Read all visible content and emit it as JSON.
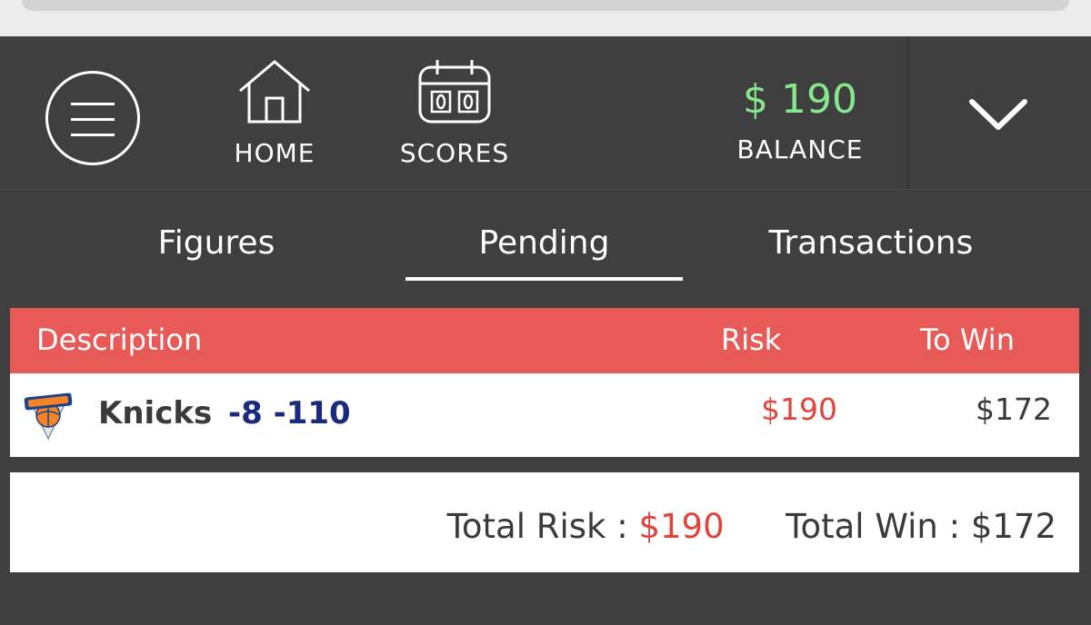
{
  "header": {
    "nav": {
      "home_label": "HOME",
      "scores_label": "SCORES"
    },
    "balance": {
      "amount": "$ 190",
      "label": "BALANCE"
    }
  },
  "tabs": [
    {
      "label": "Figures"
    },
    {
      "label": "Pending",
      "active": true
    },
    {
      "label": "Transactions"
    }
  ],
  "table": {
    "columns": {
      "description": "Description",
      "risk": "Risk",
      "to_win": "To Win"
    },
    "rows": [
      {
        "team": "Knicks",
        "line": "-8 -110",
        "risk": "$190",
        "to_win": "$172",
        "logo": "knicks-logo"
      }
    ]
  },
  "totals": {
    "risk_label": "Total Risk :",
    "risk_value": "$190",
    "win_label": "Total Win :",
    "win_value": "$172"
  },
  "colors": {
    "background": "#3f3f3f",
    "accent_header": "#e85a57",
    "balance_green": "#86e78f",
    "risk_red": "#e0443a",
    "line_blue": "#1a2a7e"
  },
  "icons": [
    "menu-icon",
    "home-icon",
    "scoreboard-icon",
    "chevron-down-icon"
  ]
}
